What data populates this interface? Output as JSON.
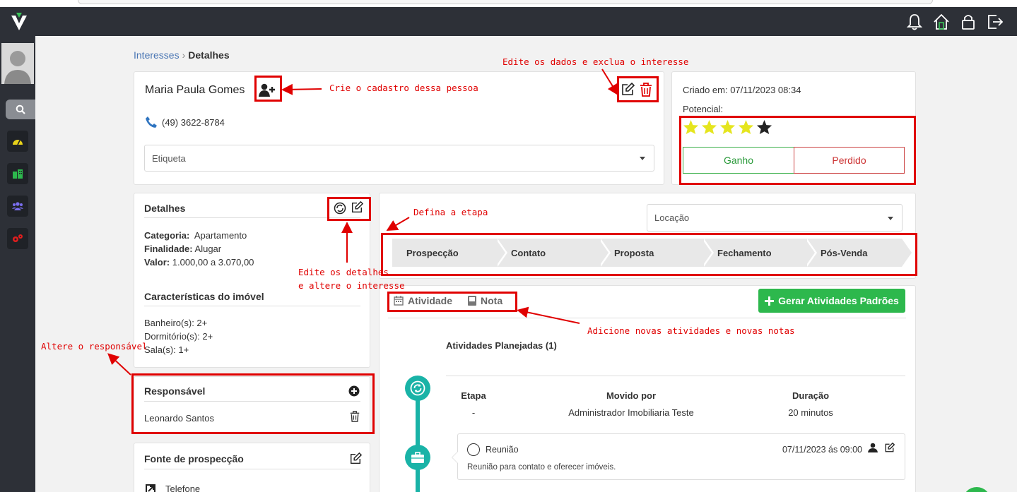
{
  "breadcrumb": {
    "parent": "Interesses",
    "current": "Detalhes"
  },
  "lead": {
    "name": "Maria Paula Gomes",
    "phone": "(49) 3622-8784",
    "tag_placeholder": "Etiqueta"
  },
  "summary": {
    "created_label": "Criado em:",
    "created_value": "07/11/2023 08:34",
    "potential_label": "Potencial:",
    "stars_filled": 4,
    "stars_total": 5,
    "win_label": "Ganho",
    "lose_label": "Perdido"
  },
  "details": {
    "title": "Detalhes",
    "rows": [
      {
        "label": "Categoria:",
        "value": "Apartamento"
      },
      {
        "label": "Finalidade:",
        "value": "Alugar"
      },
      {
        "label": "Valor:",
        "value": "1.000,00 a 3.070,00"
      }
    ],
    "features_title": "Características do imóvel",
    "features": [
      "Banheiro(s): 2+",
      "Dormitório(s): 2+",
      "Sala(s): 1+"
    ]
  },
  "responsible": {
    "title": "Responsável",
    "name": "Leonardo Santos"
  },
  "source": {
    "title": "Fonte de prospecção",
    "value": "Telefone"
  },
  "funnel": {
    "selected": "Locação",
    "stages": [
      "Prospecção",
      "Contato",
      "Proposta",
      "Fechamento",
      "Pós-Venda"
    ]
  },
  "tabs": {
    "activity": "Atividade",
    "note": "Nota",
    "generate_button": "Gerar Atividades Padrões"
  },
  "timeline": {
    "planned_title": "Atividades Planejadas (1)",
    "headers": {
      "stage": "Etapa",
      "moved_by": "Movido por",
      "duration": "Duração"
    },
    "values": {
      "stage": "-",
      "moved_by": "Administrador Imobiliaria Teste",
      "duration": "20 minutos"
    },
    "activity": {
      "title": "Reunião",
      "datetime": "07/11/2023 ás 09:00",
      "description": "Reunião para contato e oferecer imóveis."
    }
  },
  "annotations": {
    "edit_delete": "Edite os dados e exclua o interesse",
    "create_person": "Crie o cadastro dessa pessoa",
    "set_stage": "Defina a etapa",
    "edit_details_1": "Edite os detalhes",
    "edit_details_2": "e altere o interesse",
    "change_responsible": "Altere o responsável",
    "add_activities": "Adicione novas atividades e novas notas"
  },
  "colors": {
    "topbar": "#2d3037",
    "accent_green": "#2db84d",
    "timeline_teal": "#19b3a7",
    "annotation_red": "#e00000",
    "star": "#e5e51e"
  }
}
